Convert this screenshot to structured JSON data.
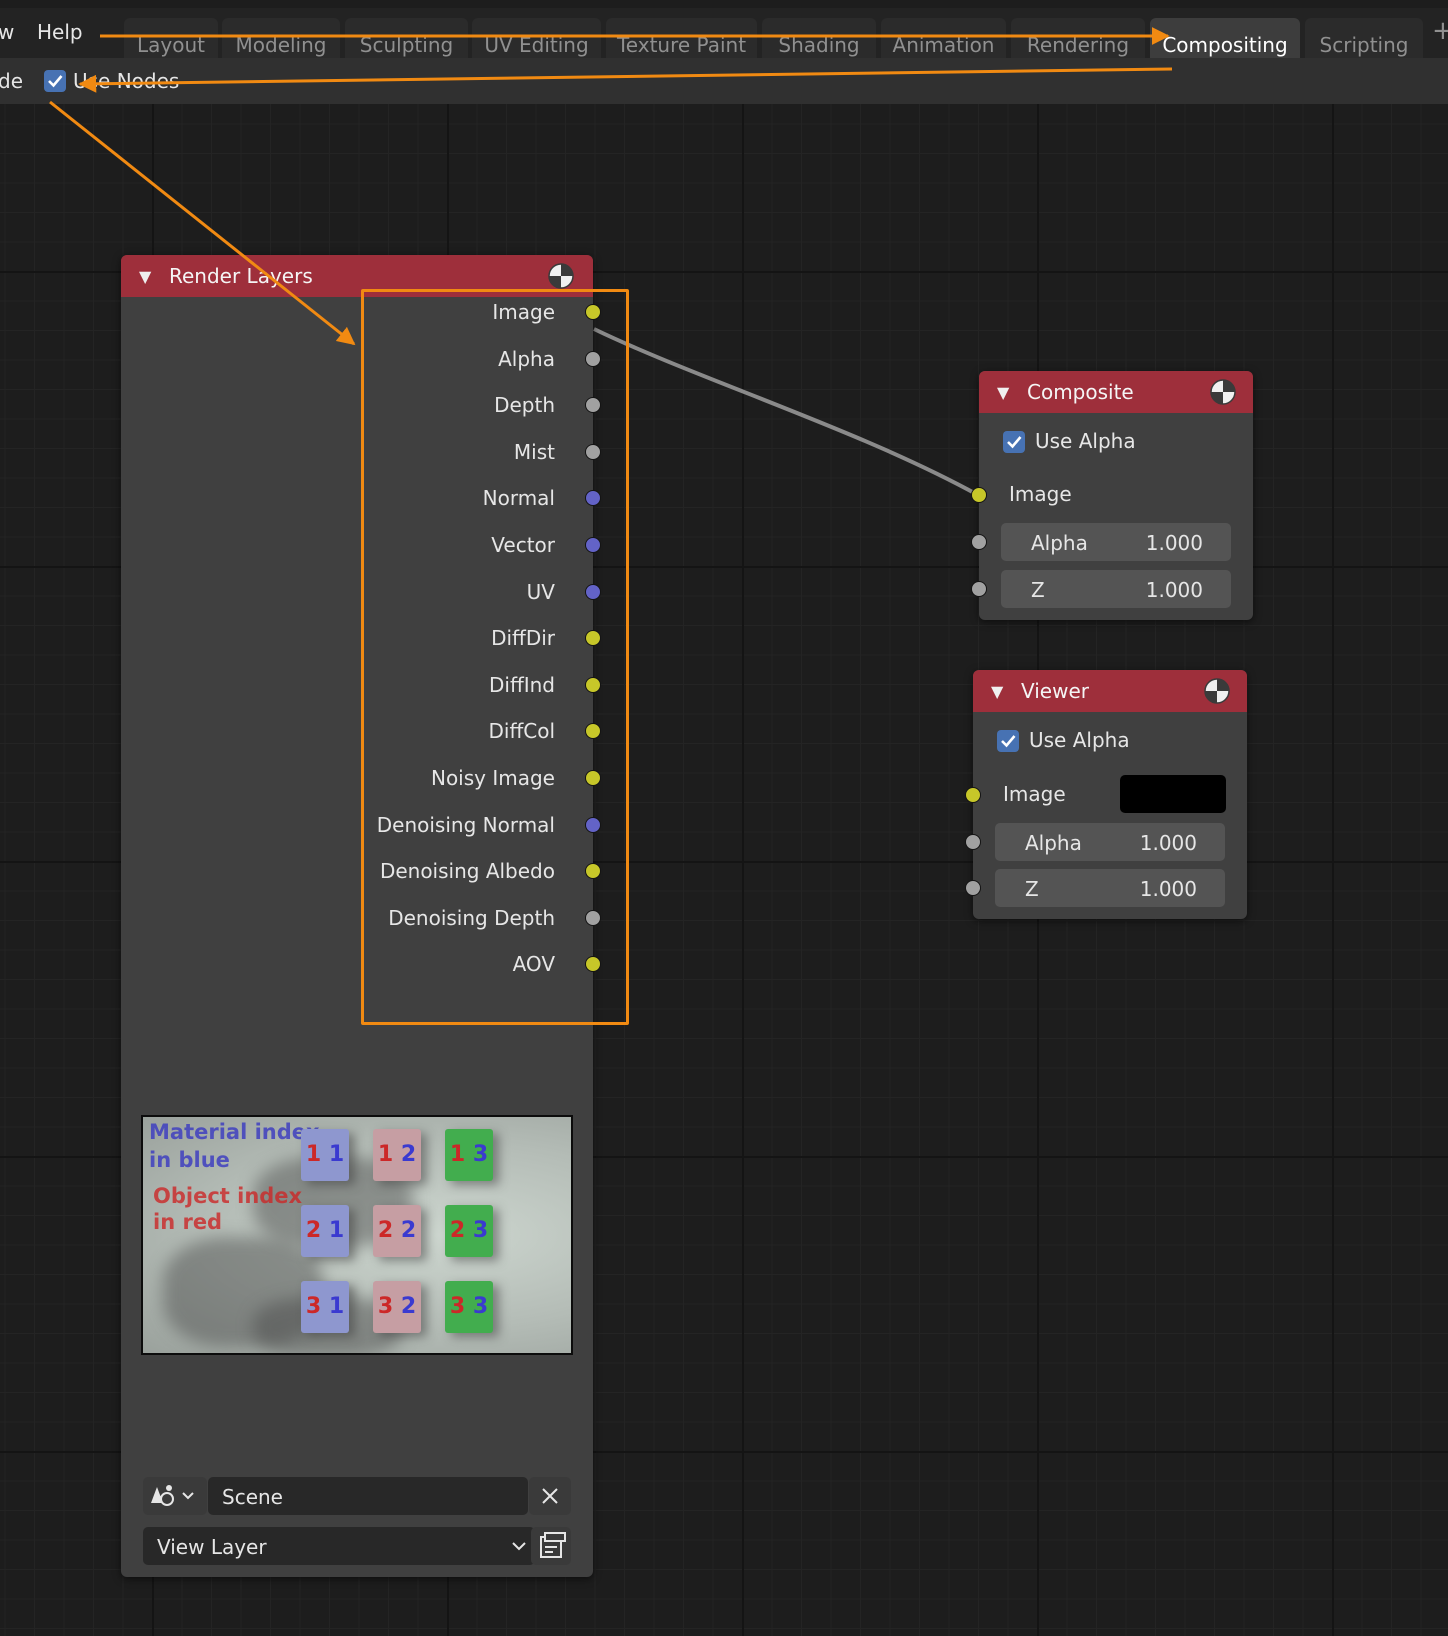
{
  "topbar": {
    "menu_items": [
      "w",
      "Help"
    ],
    "tabs": [
      "Layout",
      "Modeling",
      "Sculpting",
      "UV Editing",
      "Texture Paint",
      "Shading",
      "Animation",
      "Rendering",
      "Compositing",
      "Scripting"
    ],
    "active_tab": "Compositing",
    "add_tab": "+"
  },
  "header": {
    "mode_fragment": "de",
    "use_nodes_label": "Use Nodes",
    "use_nodes_checked": true
  },
  "render_layers": {
    "title": "Render Layers",
    "outputs": [
      {
        "label": "Image",
        "socket": "color"
      },
      {
        "label": "Alpha",
        "socket": "value"
      },
      {
        "label": "Depth",
        "socket": "value"
      },
      {
        "label": "Mist",
        "socket": "value"
      },
      {
        "label": "Normal",
        "socket": "vector"
      },
      {
        "label": "Vector",
        "socket": "vector"
      },
      {
        "label": "UV",
        "socket": "vector"
      },
      {
        "label": "DiffDir",
        "socket": "color"
      },
      {
        "label": "DiffInd",
        "socket": "color"
      },
      {
        "label": "DiffCol",
        "socket": "color"
      },
      {
        "label": "Noisy Image",
        "socket": "color"
      },
      {
        "label": "Denoising Normal",
        "socket": "vector"
      },
      {
        "label": "Denoising Albedo",
        "socket": "color"
      },
      {
        "label": "Denoising Depth",
        "socket": "value"
      },
      {
        "label": "AOV",
        "socket": "color"
      }
    ],
    "preview": {
      "line1": "Material index",
      "line2": "in blue",
      "line3": "Object index",
      "line4": "in red",
      "cubes": [
        {
          "blue_digit": "1",
          "red_digit": "1",
          "color": "blue"
        },
        {
          "blue_digit": "2",
          "red_digit": "1",
          "color": "pink"
        },
        {
          "blue_digit": "3",
          "red_digit": "1",
          "color": "green"
        },
        {
          "blue_digit": "1",
          "red_digit": "2",
          "color": "blue"
        },
        {
          "blue_digit": "2",
          "red_digit": "2",
          "color": "pink"
        },
        {
          "blue_digit": "3",
          "red_digit": "2",
          "color": "green"
        },
        {
          "blue_digit": "1",
          "red_digit": "3",
          "color": "blue"
        },
        {
          "blue_digit": "2",
          "red_digit": "3",
          "color": "pink"
        },
        {
          "blue_digit": "3",
          "red_digit": "3",
          "color": "green"
        }
      ]
    },
    "scene_value": "Scene",
    "view_layer_value": "View Layer"
  },
  "composite": {
    "title": "Composite",
    "use_alpha_label": "Use Alpha",
    "use_alpha_checked": true,
    "image_label": "Image",
    "alpha_label": "Alpha",
    "alpha_value": "1.000",
    "z_label": "Z",
    "z_value": "1.000"
  },
  "viewer": {
    "title": "Viewer",
    "use_alpha_label": "Use Alpha",
    "use_alpha_checked": true,
    "image_label": "Image",
    "image_color": "#000000",
    "alpha_label": "Alpha",
    "alpha_value": "1.000",
    "z_label": "Z",
    "z_value": "1.000"
  },
  "colors": {
    "node_header": "#9e2f3b",
    "socket_color": "#c7c729",
    "socket_value": "#a1a1a1",
    "socket_vector": "#6363c7",
    "annotation": "#f18a12",
    "accent": "#4772b3"
  }
}
